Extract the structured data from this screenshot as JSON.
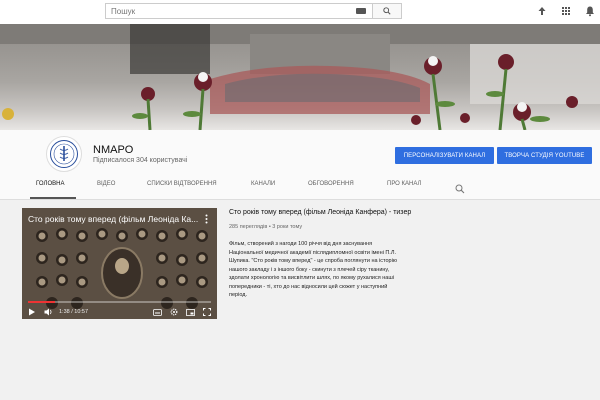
{
  "search": {
    "placeholder": "Пошук"
  },
  "channel": {
    "name": "NMAPO",
    "subscribers": "Підписалося 304 користувачі",
    "customize_button": "ПЕРСОНАЛІЗУВАТИ КАНАЛ",
    "studio_button": "ТВОРЧА СТУДІЯ YOUTUBE"
  },
  "tabs": [
    "ГОЛОВНА",
    "ВІДЕО",
    "СПИСКИ ВІДТВОРЕННЯ",
    "КАНАЛИ",
    "ОБГОВОРЕННЯ",
    "ПРО КАНАЛ"
  ],
  "active_tab": "ГОЛОВНА",
  "video": {
    "player_title": "Сто років тому вперед (фільм Леоніда Ка...",
    "time": "1:38 / 10:57",
    "progress": 0.15,
    "title": "Сто років тому вперед (фільм Леоніда Канфера) - тизер",
    "meta": "285 переглядів • 3 роки тому",
    "description": "Фільм, створений з нагоди 100 річчя від дня заснування Національної медичної академії післядипломної освіти імені П.Л. Шупика. \"Сто років тому вперед\" - це спроба поглянути на історію нашого закладу і з іншого боку - скинути з плечей сіру тканину, здолати хронологію та висвітлити шлях, по якому рухалися наші попередники - ті, хто до нас відносили цей сюжет у наступний період."
  },
  "colors": {
    "accent_blue": "#2f6ee0",
    "progress_red": "#e33333"
  }
}
